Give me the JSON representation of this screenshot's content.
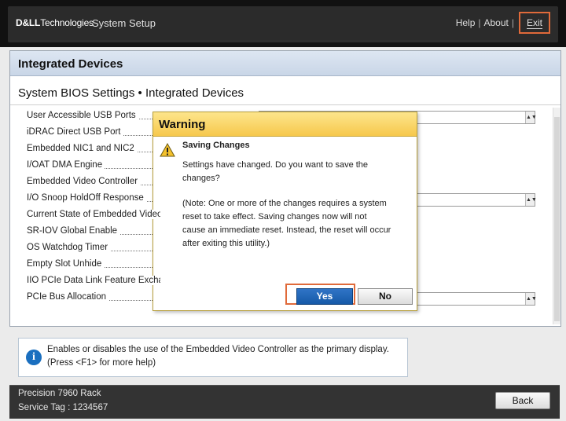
{
  "header": {
    "logo_text_bold": "D&LL",
    "logo_text": "Technologies",
    "app_title": "System Setup",
    "links": {
      "help": "Help",
      "about": "About",
      "exit": "Exit"
    },
    "separator": "|"
  },
  "panel": {
    "title": "Integrated Devices",
    "subtitle": "System BIOS Settings • Integrated Devices",
    "settings": [
      {
        "label": "User Accessible USB Ports"
      },
      {
        "label": "iDRAC Direct USB Port"
      },
      {
        "label": "Embedded NIC1 and NIC2"
      },
      {
        "label": "I/OAT DMA Engine"
      },
      {
        "label": "Embedded Video Controller"
      },
      {
        "label": "I/O Snoop HoldOff Response"
      },
      {
        "label": "Current State of Embedded Video Controller"
      },
      {
        "label": "SR-IOV Global Enable"
      },
      {
        "label": "OS Watchdog Timer"
      },
      {
        "label": "Empty Slot Unhide"
      },
      {
        "label": "IIO PCIe Data Link Feature Exchange"
      },
      {
        "label": "PCIe Bus Allocation"
      }
    ]
  },
  "help": {
    "icon": "info-icon",
    "line1": "Enables or disables the use of the Embedded Video Controller as the primary display.",
    "line2": "(Press <F1> for more help)"
  },
  "footer": {
    "model": "Precision 7960 Rack",
    "service_tag": "Service Tag : 1234567",
    "back_label": "Back"
  },
  "dialog": {
    "title": "Warning",
    "icon": "warning-icon",
    "heading": "Saving Changes",
    "message_line1": "Settings have changed. Do you want to save the",
    "message_line2": "changes?",
    "note_line1": "(Note: One or more of the changes requires a system",
    "note_line2": "reset to take effect. Saving changes now will not",
    "note_line3": "cause an immediate reset. Instead, the reset will occur",
    "note_line4": "after exiting this utility.)",
    "yes_label": "Yes",
    "no_label": "No"
  },
  "colors": {
    "accent_highlight": "#e06a3a",
    "dialog_header": "#f6c84c",
    "primary_button": "#1f66b8",
    "panel_header": "#c9d6e7"
  }
}
